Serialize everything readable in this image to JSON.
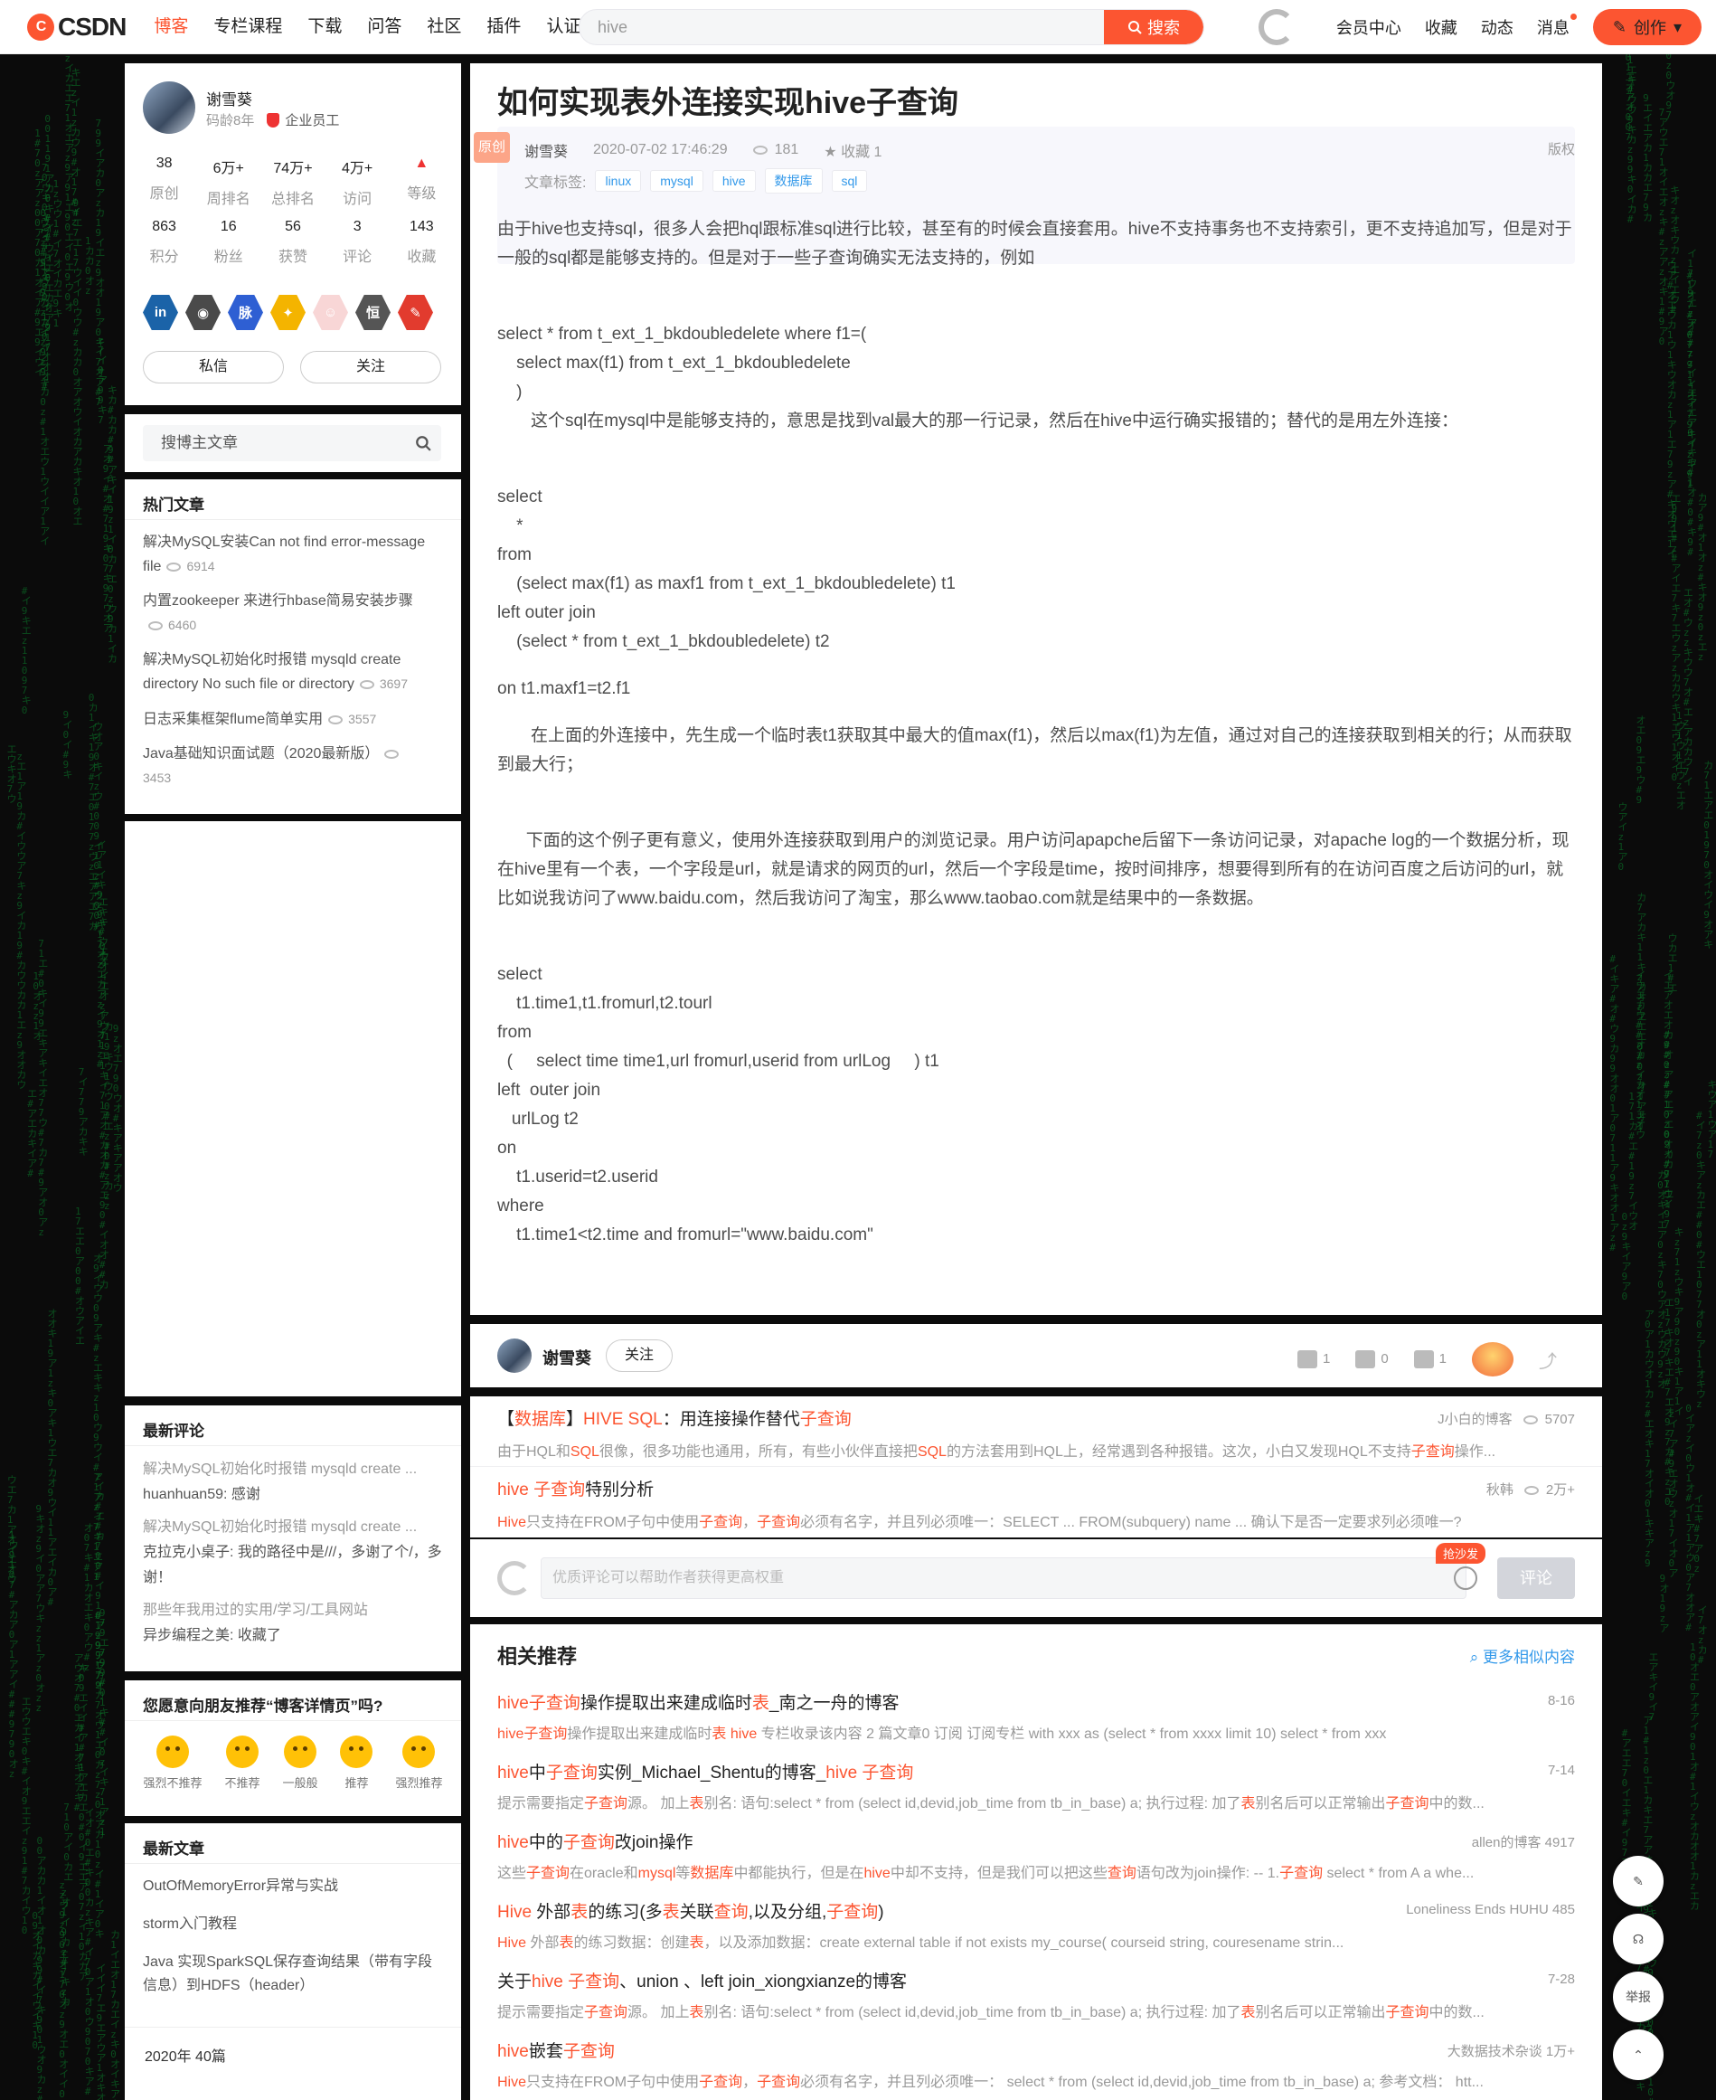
{
  "nav": {
    "logo_text": "CSDN",
    "items": [
      "博客",
      "专栏课程",
      "下载",
      "问答",
      "社区",
      "插件",
      "认证"
    ],
    "search_value": "hive",
    "search_button": "搜索",
    "right": [
      "会员中心",
      "收藏",
      "动态",
      "消息"
    ],
    "create": "创作"
  },
  "profile": {
    "name": "谢雪葵",
    "years": "码龄8年",
    "role": "企业员工",
    "stats1": [
      {
        "n": "38",
        "l": "原创"
      },
      {
        "n": "6万+",
        "l": "周排名"
      },
      {
        "n": "74万+",
        "l": "总排名"
      },
      {
        "n": "4万+",
        "l": "访问"
      },
      {
        "n": "",
        "l": "等级"
      }
    ],
    "stats2": [
      {
        "n": "863",
        "l": "积分"
      },
      {
        "n": "16",
        "l": "粉丝"
      },
      {
        "n": "56",
        "l": "获赞"
      },
      {
        "n": "3",
        "l": "评论"
      },
      {
        "n": "143",
        "l": "收藏"
      }
    ],
    "message": "私信",
    "follow": "关注"
  },
  "side_search_placeholder": "搜博主文章",
  "hot": {
    "title": "热门文章",
    "items": [
      {
        "t": "解决MySQL安装Can not find error-message file",
        "c": "6914"
      },
      {
        "t": "内置zookeeper 来进行hbase简易安装步骤",
        "c": "6460"
      },
      {
        "t": "解决MySQL初始化时报错 mysqld create directory No such file or directory",
        "c": "3697"
      },
      {
        "t": "日志采集框架flume简单实用",
        "c": "3557"
      },
      {
        "t": "Java基础知识面试题（2020最新版）",
        "c": "3453"
      }
    ]
  },
  "comments": {
    "title": "最新评论",
    "lines": [
      {
        "a": "解决MySQL初始化时报错 mysqld create ...",
        "b": "huanhuan59: 感谢"
      },
      {
        "a": "解决MySQL初始化时报错 mysqld create ...",
        "b": "克拉克小桌子: 我的路径中是///，多谢了个/，多谢！"
      },
      {
        "a": "那些年我用过的实用/学习/工具网站",
        "b": "异步编程之美: 收藏了"
      }
    ]
  },
  "recommend": {
    "title": "您愿意向朋友推荐“博客详情页”吗?",
    "faces": [
      "强烈不推荐",
      "不推荐",
      "一般般",
      "推荐",
      "强烈推荐"
    ]
  },
  "latest": {
    "title": "最新文章",
    "items": [
      "OutOfMemoryError异常与实战",
      "storm入门教程",
      "Java 实现SparkSQL保存查询结果（带有字段信息）到HDFS（header）"
    ],
    "archive": "2020年  40篇"
  },
  "article": {
    "title": "如何实现表外连接实现hive子查询",
    "badge": "原创",
    "author": "谢雪葵",
    "date": "2020-07-02 17:46:29",
    "views": "181",
    "favorite": "收藏 1",
    "copyright": "版权",
    "tags_label": "文章标签:",
    "tags": [
      "linux",
      "mysql",
      "hive",
      "数据库",
      "sql"
    ],
    "p1": "由于hive也支持sql，很多人会把hql跟标准sql进行比较，甚至有的时候会直接套用。hive不支持事务也不支持索引，更不支持追加写，但是对于一般的sql都是能够支持的。但是对于一些子查询确实无法支持的，例如",
    "code1": [
      "select * from t_ext_1_bkdoubledelete where f1=(",
      "    select max(f1) from t_ext_1_bkdoubledelete",
      "    )",
      "       这个sql在mysql中是能够支持的，意思是找到val最大的那一行记录，然后在hive中运行确实报错的；替代的是用左外连接："
    ],
    "code2": [
      "select",
      "    *",
      "from",
      "    (select max(f1) as maxf1 from t_ext_1_bkdoubledelete) t1",
      "left outer join",
      "    (select * from t_ext_1_bkdoubledelete) t2"
    ],
    "code3": "on t1.maxf1=t2.f1",
    "p2": "       在上面的外连接中，先生成一个临时表t1获取其中最大的值max(f1)，然后以max(f1)为左值，通过对自己的连接获取到相关的行；从而获取到最大行；",
    "p3": "      下面的这个例子更有意义，使用外连接获取到用户的浏览记录。用户访问apapche后留下一条访问记录，对apache log的一个数据分析，现在hive里有一个表，一个字段是url，就是请求的网页的url，然后一个字段是time，按时间排序，想要得到所有的在访问百度之后访问的url，就比如说我访问了www.baidu.com，然后我访问了淘宝，那么www.taobao.com就是结果中的一条数据。",
    "code4": [
      "select",
      "    t1.time1,t1.fromurl,t2.tourl",
      "from",
      "  (     select time time1,url fromurl,userid from urlLog     ) t1",
      "left  outer join",
      "   urlLog t2",
      "on",
      "    t1.userid=t2.userid",
      "where",
      "    t1.time1<t2.time and fromurl=\"www.baidu.com\""
    ]
  },
  "footbar": {
    "name": "谢雪葵",
    "follow": "关注",
    "likes": "1",
    "comments": "0",
    "stars": "1"
  },
  "related": [
    {
      "pre": "【",
      "h1": "数据库",
      "mid": "】",
      "h2": "HIVE SQL",
      "post": "：用连接操作替代",
      "h3": "子查询",
      "author": "J小白的博客",
      "count": "5707",
      "desc": "由于HQL和SQL很像，很多功能也通用，所有，有些小伙伴直接把SQL的方法套用到HQL上，经常遇到各种报错。这次，小白又发现HQL不支持子查询操作..."
    },
    {
      "pre": "",
      "h1": "hive 子查询",
      "mid": "特别分析",
      "h2": "",
      "post": "",
      "h3": "",
      "author": "秋韩",
      "count": "2万+",
      "desc": "Hive只支持在FROM子句中使用子查询，子查询必须有名字，并且列必须唯一：SELECT ... FROM(subquery) name ... 确认下是否一定要求列必须唯一?"
    }
  ],
  "comment_box": {
    "placeholder": "优质评论可以帮助作者获得更高权重",
    "hot": "抢沙发",
    "send": "评论"
  },
  "recs": {
    "title": "相关推荐",
    "more": "更多相似内容",
    "items": [
      {
        "title": "hive子查询操作提取出来建成临时表_南之一舟的博客",
        "right": "8-16",
        "desc": "hive子查询操作提取出来建成临时表 hive 专栏收录该内容 2 篇文章0 订阅 订阅专栏 with xxx as (select * from xxxx limit 10) select * from xxx"
      },
      {
        "title": "hive中子查询实例_Michael_Shentu的博客_hive 子查询",
        "right": "7-14",
        "desc": "提示需要指定子查询源。 加上表别名: 语句:select * from (select id,devid,job_time from tb_in_base) a; 执行过程: 加了表别名后可以正常输出子查询中的数..."
      },
      {
        "title": "hive中的子查询改join操作",
        "right": "allen的博客    4917",
        "desc": "这些子查询在oracle和mysql等数据库中都能执行，但是在hive中却不支持，但是我们可以把这些查询语句改为join操作: -- 1.子查询 select * from A a whe..."
      },
      {
        "title": "Hive 外部表的练习(多表关联查询,以及分组,子查询)",
        "right": "Loneliness Ends HUHU    485",
        "desc": "Hive 外部表的练习数据：创建表，以及添加数据：create external table if not exists my_course( courseid string, couresename strin..."
      },
      {
        "title": "关于hive 子查询、union 、left join_xiongxianze的博客",
        "right": "7-28",
        "desc": "提示需要指定子查询源。 加上表别名: 语句:select * from (select id,devid,job_time from tb_in_base) a; 执行过程: 加了表别名后可以正常输出子查询中的数..."
      },
      {
        "title": "hive嵌套子查询",
        "right": "大数据技术杂谈    1万+",
        "desc": "Hive只支持在FROM子句中使用子查询，子查询必须有名字，并且列必须唯一：  select * from (select id,devid,job_time from tb_in_base) a; 参考文档：  htt..."
      }
    ]
  },
  "float": {
    "report": "举报"
  },
  "colors": {
    "accent": "#fc5531",
    "link": "#3399ea",
    "bg": "#0b0b0b"
  }
}
